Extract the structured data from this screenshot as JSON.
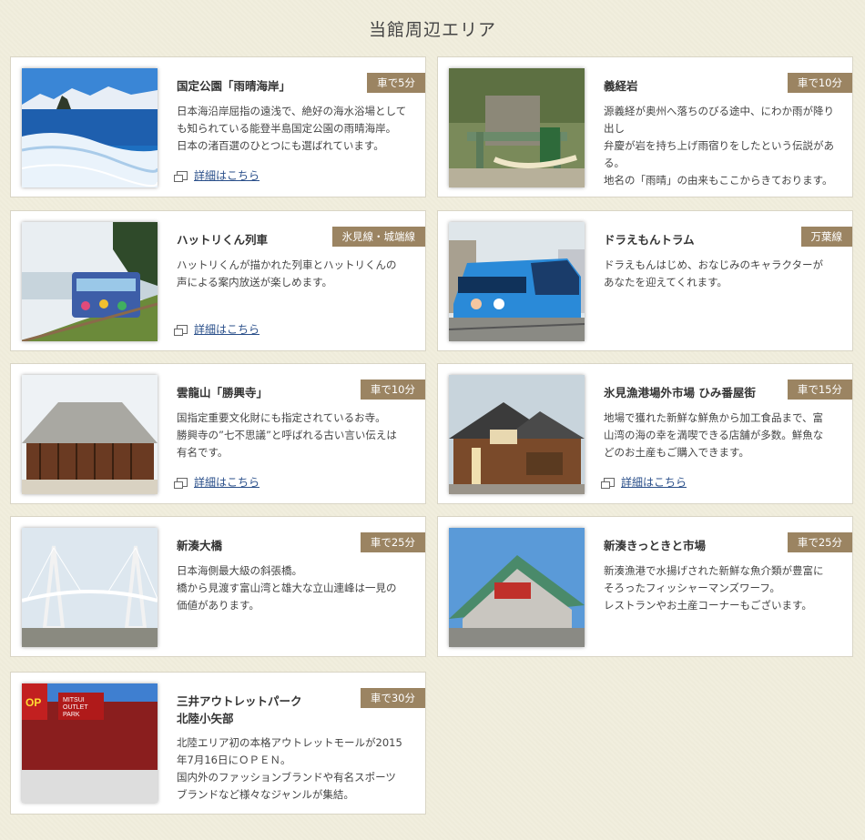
{
  "page": {
    "title": "当館周辺エリア"
  },
  "more_label": "詳細はこちら",
  "colors": {
    "badge": "#9b8462",
    "link": "#2a4f8a",
    "background": "#f1eedd"
  },
  "spots": [
    {
      "name": "国定公園「雨晴海岸」",
      "badge": "車で5分",
      "desc": [
        "日本海沿岸屈指の遠浅で、絶好の海水浴場として",
        "も知られている能登半島国定公園の雨晴海岸。",
        "日本の渚百選のひとつにも選ばれています。"
      ],
      "image": "coast-photo"
    },
    {
      "name": "義経岩",
      "badge": "車で10分",
      "desc": [
        "源義経が奥州へ落ちのびる途中、にわか雨が降り出し",
        "弁慶が岩を持ち上げ雨宿りをしたという伝説がある。",
        "地名の「雨晴」の由来もここからきております。"
      ],
      "image": "shrine-rock-photo"
    },
    {
      "name": "ハットリくん列車",
      "badge": "氷見線・城端線",
      "desc": [
        "ハットリくんが描かれた列車とハットリくんの",
        "声による案内放送が楽しめます。"
      ],
      "image": "train-photo"
    },
    {
      "name": "ドラえもんトラム",
      "badge": "万葉線",
      "desc": [
        "ドラえもんはじめ、おなじみのキャラクターが",
        "あなたを迎えてくれます。"
      ],
      "image": "tram-photo"
    },
    {
      "name": "雲龍山「勝興寺」",
      "badge": "車で10分",
      "desc": [
        "国指定重要文化財にも指定されているお寺。",
        "勝興寺の”七不思議”と呼ばれる古い言い伝えは",
        "有名です。"
      ],
      "image": "temple-photo"
    },
    {
      "name": "氷見漁港場外市場 ひみ番屋街",
      "badge": "車で15分",
      "desc": [
        "地場で獲れた新鮮な鮮魚から加工食品まで、富",
        "山湾の海の幸を満喫できる店舗が多数。鮮魚な",
        "どのお土産もご購入できます。"
      ],
      "image": "market-photo"
    },
    {
      "name": "新湊大橋",
      "badge": "車で25分",
      "desc": [
        "日本海側最大級の斜張橋。",
        "橋から見渡す富山湾と雄大な立山連峰は一見の",
        "価値があります。"
      ],
      "image": "bridge-photo"
    },
    {
      "name": "新湊きっときと市場",
      "badge": "車で25分",
      "desc": [
        "新湊漁港で水揚げされた新鮮な魚介類が豊富に",
        "そろったフィッシャーマンズワーフ。",
        "レストランやお土産コーナーもございます。"
      ],
      "image": "fish-market-photo"
    },
    {
      "name": "三井アウトレットパーク",
      "name2": "北陸小矢部",
      "badge": "車で30分",
      "desc": [
        "北陸エリア初の本格アウトレットモールが2015",
        "年7月16日にＯＰＥＮ。",
        "国内外のファッションブランドや有名スポーツ",
        "ブランドなど様々なジャンルが集結。"
      ],
      "image": "outlet-photo",
      "image_text": {
        "logo": "OP",
        "sign1": "MITSUI",
        "sign2": "OUTLET",
        "sign3": "PARK"
      }
    }
  ]
}
